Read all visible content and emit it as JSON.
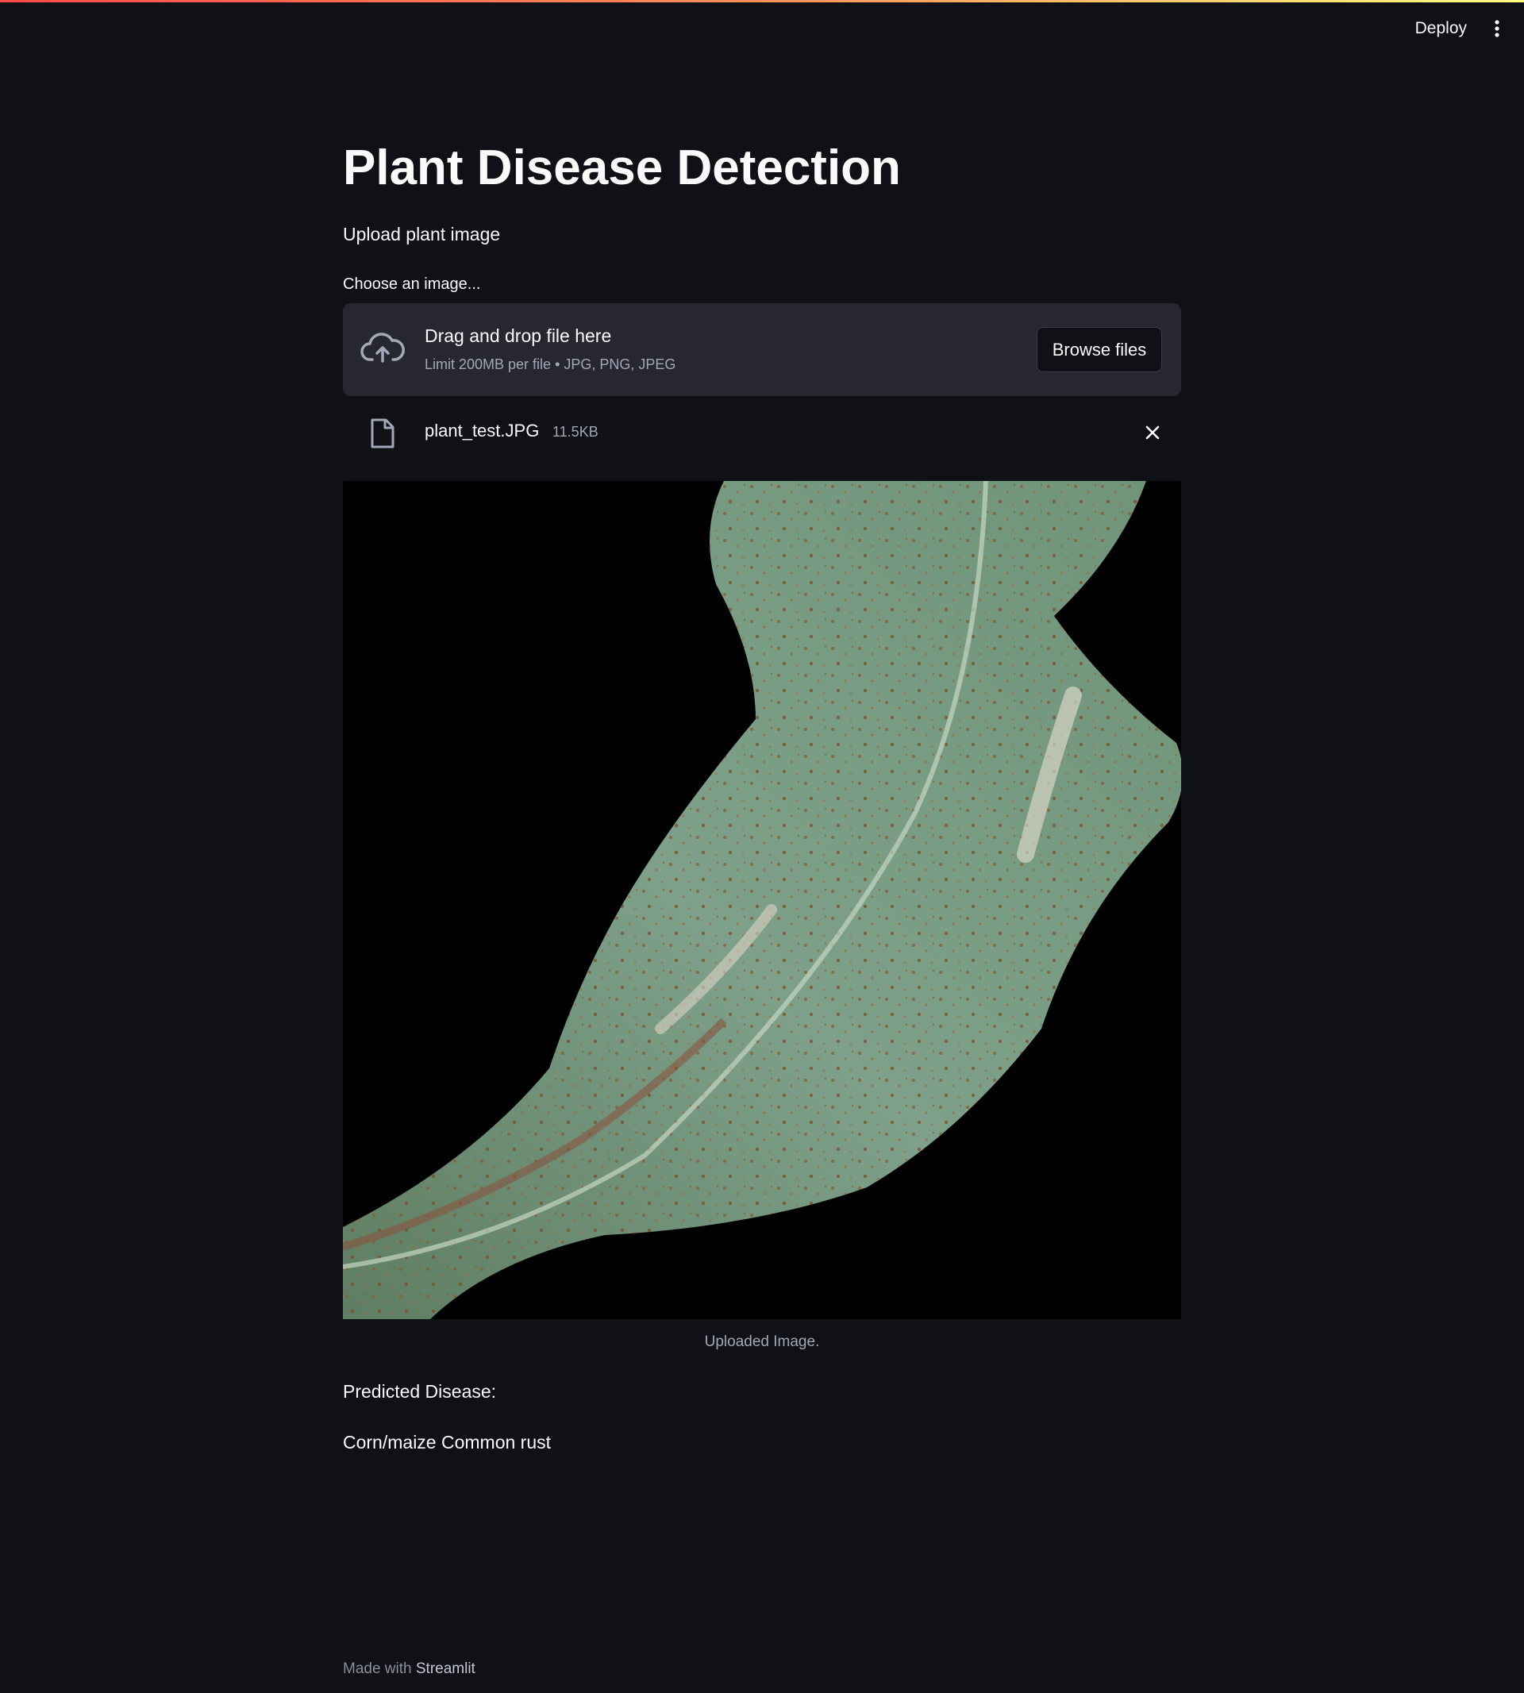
{
  "header": {
    "deploy_label": "Deploy",
    "menu_icon": "more-vertical-icon"
  },
  "main": {
    "title": "Plant Disease Detection",
    "subtitle": "Upload plant image"
  },
  "uploader": {
    "label": "Choose an image...",
    "dropzone_title": "Drag and drop file here",
    "dropzone_limit": "Limit 200MB per file • JPG, PNG, JPEG",
    "browse_label": "Browse files",
    "icon": "cloud-upload-icon"
  },
  "file": {
    "name": "plant_test.JPG",
    "size": "11.5KB",
    "icon": "file-icon",
    "remove_icon": "close-icon"
  },
  "image": {
    "caption": "Uploaded Image."
  },
  "prediction": {
    "label": "Predicted Disease:",
    "value": "Corn/maize Common rust"
  },
  "footer": {
    "prefix": "Made with ",
    "brand": "Streamlit"
  },
  "colors": {
    "background": "#0f1117",
    "dropzone": "#262730",
    "text": "#fafafa",
    "muted": "#a3a8b8",
    "accent": "#ff4b4b"
  }
}
